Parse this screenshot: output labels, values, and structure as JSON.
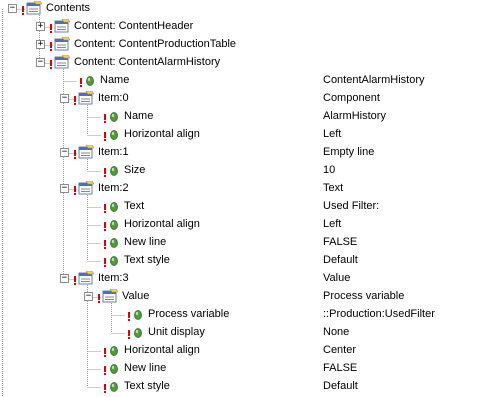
{
  "tree": {
    "rows": [
      {
        "label": "Contents",
        "value": "",
        "kind": "node",
        "level": 0,
        "expander": "−"
      },
      {
        "label": "Content: ContentHeader",
        "value": "",
        "kind": "node",
        "level": 1,
        "expander": "+"
      },
      {
        "label": "Content: ContentProductionTable",
        "value": "",
        "kind": "node",
        "level": 1,
        "expander": "+"
      },
      {
        "label": "Content: ContentAlarmHistory",
        "value": "",
        "kind": "node",
        "level": 1,
        "expander": "−"
      },
      {
        "label": "Name",
        "value": "ContentAlarmHistory",
        "kind": "leaf",
        "level": 2,
        "expander": ""
      },
      {
        "label": "Item:0",
        "value": "Component",
        "kind": "node",
        "level": 2,
        "expander": "−"
      },
      {
        "label": "Name",
        "value": "AlarmHistory",
        "kind": "leaf",
        "level": 3,
        "expander": ""
      },
      {
        "label": "Horizontal align",
        "value": "Left",
        "kind": "leaf",
        "level": 3,
        "expander": ""
      },
      {
        "label": "Item:1",
        "value": "Empty line",
        "kind": "node",
        "level": 2,
        "expander": "−"
      },
      {
        "label": "Size",
        "value": "10",
        "kind": "leaf",
        "level": 3,
        "expander": ""
      },
      {
        "label": "Item:2",
        "value": "Text",
        "kind": "node",
        "level": 2,
        "expander": "−"
      },
      {
        "label": "Text",
        "value": "Used Filter:",
        "kind": "leaf",
        "level": 3,
        "expander": ""
      },
      {
        "label": "Horizontal align",
        "value": "Left",
        "kind": "leaf",
        "level": 3,
        "expander": ""
      },
      {
        "label": "New line",
        "value": "FALSE",
        "kind": "leaf",
        "level": 3,
        "expander": ""
      },
      {
        "label": "Text style",
        "value": "Default",
        "kind": "leaf",
        "level": 3,
        "expander": ""
      },
      {
        "label": "Item:3",
        "value": "Value",
        "kind": "node",
        "level": 2,
        "expander": "−"
      },
      {
        "label": "Value",
        "value": "Process variable",
        "kind": "node",
        "level": 3,
        "expander": "−"
      },
      {
        "label": "Process variable",
        "value": "::Production:UsedFilter",
        "kind": "leaf",
        "level": 4,
        "expander": ""
      },
      {
        "label": "Unit display",
        "value": "None",
        "kind": "leaf",
        "level": 4,
        "expander": ""
      },
      {
        "label": "Horizontal align",
        "value": "Center",
        "kind": "leaf",
        "level": 3,
        "expander": ""
      },
      {
        "label": "New line",
        "value": "FALSE",
        "kind": "leaf",
        "level": 3,
        "expander": ""
      },
      {
        "label": "Text style",
        "value": "Default",
        "kind": "leaf",
        "level": 3,
        "expander": ""
      }
    ]
  },
  "icons": {
    "node": "properties-node-icon",
    "leaf": "property-leaf-icon",
    "warning": "warning-mark-icon"
  },
  "colors": {
    "warning": "#e00000",
    "leaf_green": "#4f9a3a",
    "node_yellow": "#f2d24a"
  }
}
